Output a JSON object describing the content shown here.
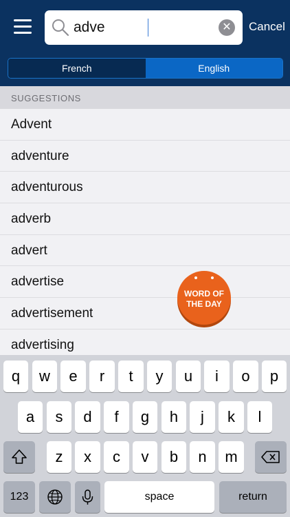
{
  "header": {
    "menu_icon": "hamburger-menu-icon",
    "search": {
      "value": "adve",
      "icon": "magnifier-icon"
    },
    "clear_icon": "clear-circle-icon",
    "clear_glyph": "✕",
    "cancel_label": "Cancel",
    "languages": [
      {
        "label": "French",
        "selected": false
      },
      {
        "label": "English",
        "selected": true
      }
    ]
  },
  "suggestions": {
    "heading": "SUGGESTIONS",
    "items": [
      "Advent",
      "adventure",
      "adventurous",
      "adverb",
      "advert",
      "advertise",
      "advertisement",
      "advertising"
    ]
  },
  "word_of_the_day": {
    "line1": "WORD OF",
    "line2": "THE DAY",
    "color": "#e9621c"
  },
  "keyboard": {
    "row1": [
      "q",
      "w",
      "e",
      "r",
      "t",
      "y",
      "u",
      "i",
      "o",
      "p"
    ],
    "row2": [
      "a",
      "s",
      "d",
      "f",
      "g",
      "h",
      "j",
      "k",
      "l"
    ],
    "row3": [
      "z",
      "x",
      "c",
      "v",
      "b",
      "n",
      "m"
    ],
    "shift_icon": "shift-icon",
    "backspace_icon": "backspace-icon",
    "numbers_label": "123",
    "globe_icon": "globe-icon",
    "mic_icon": "microphone-icon",
    "space_label": "space",
    "return_label": "return"
  },
  "colors": {
    "header": "#0b3260",
    "accent": "#0b67c5",
    "badge": "#e9621c"
  }
}
